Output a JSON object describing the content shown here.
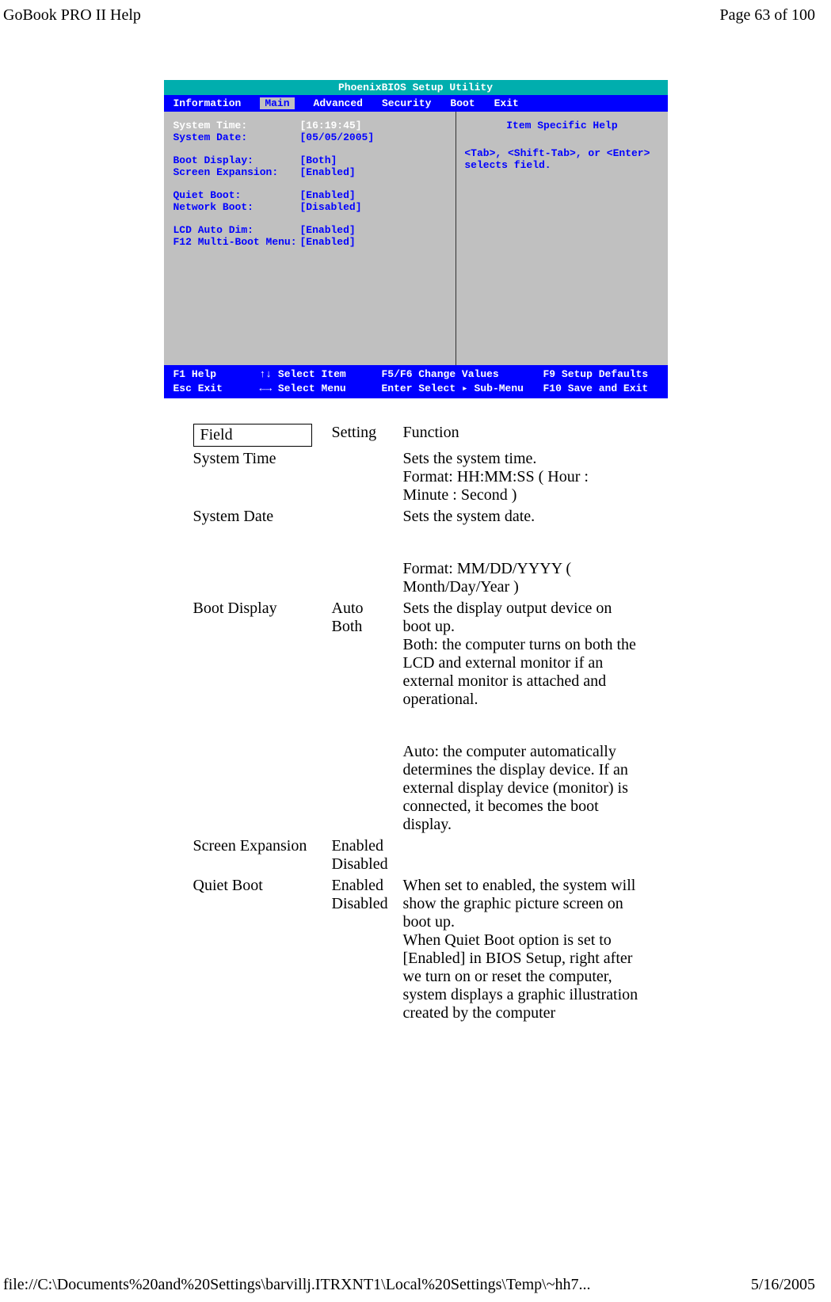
{
  "header": {
    "left": "GoBook PRO II Help",
    "right": "Page 63 of 100"
  },
  "bios": {
    "title": "PhoenixBIOS  Setup  Utility",
    "menu": [
      "Information",
      "Main",
      "Advanced",
      "Security",
      "Boot",
      "Exit"
    ],
    "main_tab_active": "Main",
    "rows": [
      {
        "label": "System Time:",
        "value": "[16:19:45]",
        "white_label": true
      },
      {
        "label": "System Date:",
        "value": "[05/05/2005]"
      },
      {
        "gap": true
      },
      {
        "label": "Boot Display:",
        "value": "[Both]"
      },
      {
        "label": "Screen Expansion:",
        "value": "[Enabled]"
      },
      {
        "gap": true
      },
      {
        "label": "Quiet  Boot:",
        "value": "[Enabled]"
      },
      {
        "label": "Network  Boot:",
        "value": "[Disabled]"
      },
      {
        "gap": true
      },
      {
        "label": "LCD  Auto  Dim:",
        "value": "[Enabled]"
      },
      {
        "label": "F12 Multi-Boot  Menu:",
        "value": "[Enabled]"
      }
    ],
    "help_title": "Item  Specific  Help",
    "help_body": "<Tab>,  <Shift-Tab>,  or <Enter>  selects  field.",
    "footer": {
      "line1_a": "F1   Help",
      "line1_b": "↑↓  Select  Item",
      "line1_c": "F5/F6  Change  Values",
      "line1_d": "F9   Setup  Defaults",
      "line2_a": "Esc  Exit",
      "line2_b": "←→  Select  Menu",
      "line2_c": "Enter  Select  ▸  Sub-Menu",
      "line2_d": "F10  Save  and  Exit"
    }
  },
  "table": {
    "headers": {
      "field": "Field",
      "setting": "Setting",
      "function": "Function"
    },
    "rows": [
      {
        "field": "System Time",
        "setting": "",
        "function": "Sets the system time.\nFormat: HH:MM:SS ( Hour : Minute : Second )"
      },
      {
        "field": "System Date",
        "setting": "",
        "function": "Sets the system date.\n\nFormat: MM/DD/YYYY ( Month/Day/Year )"
      },
      {
        "field": "Boot Display",
        "setting": "Auto\nBoth",
        "function": "Sets the display output device on boot up.\nBoth:  the computer turns on both the LCD and external monitor if an external monitor is attached and operational.\n\nAuto:  the computer automatically determines the display device. If an external display device (monitor) is connected, it becomes the boot display."
      },
      {
        "field": "Screen Expansion",
        "setting": "Enabled\nDisabled",
        "function": ""
      },
      {
        "field": "Quiet Boot",
        "setting": "Enabled\nDisabled",
        "function": "When set to enabled, the system will show the graphic picture screen on boot up.\nWhen Quiet Boot option is set to [Enabled] in BIOS Setup, right after we turn on or reset the computer, system displays a graphic illustration created by the computer"
      }
    ]
  },
  "footer": {
    "path": "file://C:\\Documents%20and%20Settings\\barvillj.ITRXNT1\\Local%20Settings\\Temp\\~hh7...",
    "date": "5/16/2005"
  }
}
